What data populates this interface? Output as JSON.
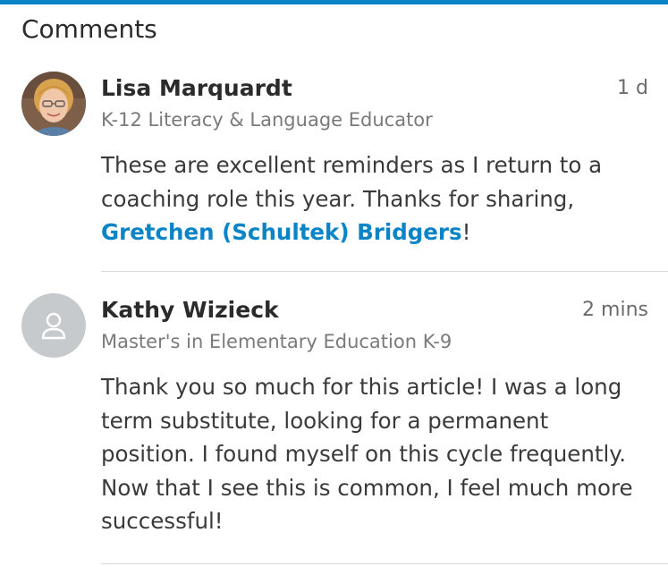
{
  "header": {
    "title": "Comments"
  },
  "colors": {
    "accent": "#0a84c6",
    "name_text": "#2b2b2b",
    "meta_text": "#7a7a7a",
    "divider": "#dadada"
  },
  "comments": [
    {
      "author": "Lisa Marquardt",
      "headline": "K-12 Literacy & Language Educator",
      "time": "1 d",
      "avatar": "profile-photo",
      "body_before": "These are excellent reminders as I return to a coaching role this year.  Thanks for sharing, ",
      "mention": "Gretchen (Schultek) Bridgers",
      "body_after": "!"
    },
    {
      "author": "Kathy Wizieck",
      "headline": "Master's in Elementary Education K-9",
      "time": "2 mins",
      "avatar": "default-person-icon",
      "body": "Thank you so much for this article! I was a long term substitute, looking for a permanent position. I found myself on this cycle frequently. Now that I see this is common, I feel much more successful!"
    }
  ]
}
